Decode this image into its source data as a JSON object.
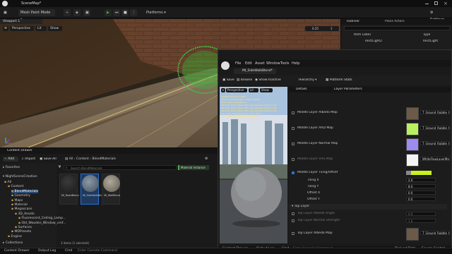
{
  "titlebar": {
    "project": "SceneMap*"
  },
  "toolbar": {
    "mode": "Mesh Paint Mode",
    "platforms": "Platforms",
    "settings": "Settings"
  },
  "viewport": {
    "tab": "Viewport 1",
    "perspective": "Perspective",
    "lit": "Lit",
    "show": "Show",
    "grid_snap": "10",
    "rot_snap": "10°",
    "scale_snap": "0.25",
    "cam_speed": "1"
  },
  "outliner": {
    "tab_outliner": "Outliner",
    "tab_place": "Place Actors",
    "col_label": "Item Label",
    "col_type": "Type",
    "row1_name": "RectLight2",
    "row1_type": "RectLight"
  },
  "mesh_paint_tab": "Mesh Paint",
  "material_editor": {
    "menu": [
      "File",
      "Edit",
      "Asset",
      "Window",
      "Tools",
      "Help"
    ],
    "tab": "MI_SideWalkBlend*",
    "save": "Save",
    "browse": "Browse",
    "show_inactive": "Show Inactive",
    "hierarchy": "Hierarchy",
    "platform_stats": "Platform Stats",
    "preview": {
      "perspective": "Perspective",
      "lit": "Lit",
      "show": "Show"
    },
    "stats_lines": [
      "Texture samplers: 6/16",
      "Texture Lookups (Est.): VS(4), PS(12)",
      "Num shadow shaders: 4",
      "Warning: Blend layer VRS map sampled (Slow) in PS",
      "Warning: Blend layer VRS map sampled (Slow) in PS",
      "Warning: Blend layer VRS map sampled (Slow) in PS",
      "Top Layer Heightmap Map: Slow Blend",
      "Top Layer Albedo Map: Slow Blend"
    ],
    "details_tab": "Details",
    "layer_params_tab": "Layer Parameters",
    "props": [
      {
        "label": "Middle Layer Albedo Map",
        "value": "T_Ground_Rubble_tc2iibnab_2K_D",
        "color": "#6b5a48"
      },
      {
        "label": "Middle Layer ARD Map",
        "value": "T_Ground_Rubble_tc2iibnab_2K_ARD",
        "color": "#b8f060"
      },
      {
        "label": "Middle Layer Normal Map",
        "value": "T_Ground_Rubble_tc2iibnab_2K_N",
        "color": "#9a8cf0"
      },
      {
        "label": "Middle Layer VRS Map",
        "value": "WhiteFlowLayerMask",
        "color": "#f4f4f4"
      },
      {
        "label": "Middle Layer Tiling/Offset",
        "value": "",
        "color": "#c8f020"
      }
    ],
    "tiling": [
      {
        "label": "Tiling X",
        "value": "2.0"
      },
      {
        "label": "Tiling Y",
        "value": "8.0"
      },
      {
        "label": "Offset X",
        "value": "0.0"
      },
      {
        "label": "Offset Y",
        "value": "0.0"
      }
    ],
    "top_layer": "Top Layer",
    "top_props": [
      {
        "label": "Top Layer Albedo Angle",
        "value": "0.0"
      },
      {
        "label": "Top Layer Normal Strength",
        "value": "1.0"
      },
      {
        "label": "Top Layer Albedo Map",
        "value": "T_Ground_Rubble_tiberedding",
        "color": "#6b5a48"
      }
    ],
    "bottom": {
      "content_drawer": "Content Drawer",
      "output_log": "Output Log",
      "cmd": "Cmd",
      "console": "Enter Console Command",
      "derived": "Derived Data",
      "source": "Source Control"
    }
  },
  "content_drawer": {
    "tab": "Content Drawer",
    "add": "Add",
    "import": "Import",
    "save_all": "Save All",
    "breadcrumb": [
      "All",
      "Content",
      "BlendMaterials"
    ],
    "favorites": "Favorites",
    "project": "NightSceneCreation",
    "search_placeholder": "Search BlendMaterials",
    "filter_tag": "Material Instance",
    "tree": [
      {
        "label": "All",
        "depth": 0
      },
      {
        "label": "Content",
        "depth": 1
      },
      {
        "label": "BlendMaterials",
        "depth": 2
      },
      {
        "label": "Geometry",
        "depth": 2
      },
      {
        "label": "Maps",
        "depth": 2
      },
      {
        "label": "Material",
        "depth": 2
      },
      {
        "label": "Megascans",
        "depth": 2
      },
      {
        "label": "3D_Assets",
        "depth": 3
      },
      {
        "label": "Fluorescent_Ceiling_Lamp...",
        "depth": 4
      },
      {
        "label": "Old_Wooden_Window_vmf...",
        "depth": 4
      },
      {
        "label": "Surfaces",
        "depth": 3
      },
      {
        "label": "MDPresets",
        "depth": 2
      },
      {
        "label": "Engine",
        "depth": 1
      }
    ],
    "assets": [
      {
        "name": "MI_RoadBlend",
        "color": "#2a2a2a"
      },
      {
        "name": "MI_SideWalkBlend",
        "color": "#5d6d7e"
      },
      {
        "name": "MI_WallBlend",
        "color": "#8a8478"
      }
    ],
    "status": "3 items (1 selected)",
    "collections": "Collections"
  },
  "bottom": {
    "content_drawer": "Content Drawer",
    "output_log": "Output Log",
    "cmd": "Cmd",
    "console": "Enter Console Command"
  }
}
